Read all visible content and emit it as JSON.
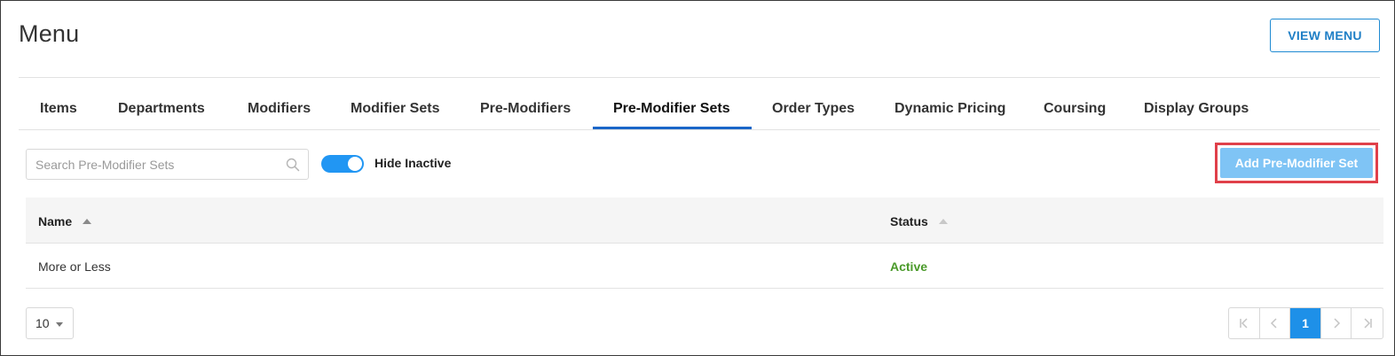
{
  "header": {
    "title": "Menu",
    "view_menu_label": "VIEW MENU"
  },
  "tabs": [
    {
      "label": "Items"
    },
    {
      "label": "Departments"
    },
    {
      "label": "Modifiers"
    },
    {
      "label": "Modifier Sets"
    },
    {
      "label": "Pre-Modifiers"
    },
    {
      "label": "Pre-Modifier Sets"
    },
    {
      "label": "Order Types"
    },
    {
      "label": "Dynamic Pricing"
    },
    {
      "label": "Coursing"
    },
    {
      "label": "Display Groups"
    }
  ],
  "active_tab": "Pre-Modifier Sets",
  "toolbar": {
    "search_placeholder": "Search Pre-Modifier Sets",
    "search_value": "",
    "hide_inactive_label": "Hide Inactive",
    "hide_inactive_on": true,
    "add_button_label": "Add Pre-Modifier Set"
  },
  "table": {
    "columns": [
      "Name",
      "Status"
    ],
    "rows": [
      {
        "name": "More or Less",
        "status": "Active"
      }
    ]
  },
  "footer": {
    "page_size": "10",
    "current_page": "1"
  },
  "colors": {
    "accent": "#1a66c8",
    "add_button": "#7fc4f5",
    "highlight_outline": "#e0404a",
    "status_active": "#4a9a2a",
    "toggle_on": "#2196f3"
  },
  "icons": [
    "search-icon",
    "sort-up-icon",
    "caret-down-icon",
    "first-page-icon",
    "previous-page-icon",
    "next-page-icon",
    "last-page-icon"
  ]
}
